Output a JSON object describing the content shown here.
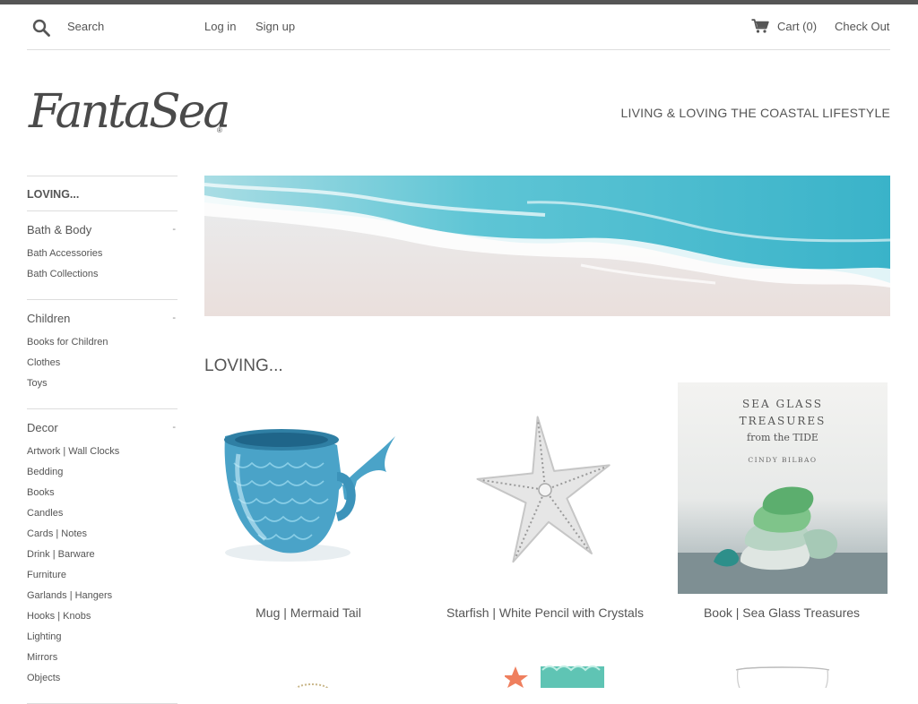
{
  "header": {
    "search_placeholder": "Search",
    "login_label": "Log in",
    "signup_label": "Sign up",
    "cart_label": "Cart (0)",
    "checkout_label": "Check Out"
  },
  "brand": {
    "logo_text": "FantaSea",
    "tagline": "LIVING & LOVING THE COASTAL LIFESTYLE"
  },
  "sidebar": {
    "current": "LOVING...",
    "groups": [
      {
        "label": "Bath & Body",
        "toggle": "-",
        "items": [
          "Bath Accessories",
          "Bath Collections"
        ]
      },
      {
        "label": "Children",
        "toggle": "-",
        "items": [
          "Books for Children",
          "Clothes",
          "Toys"
        ]
      },
      {
        "label": "Decor",
        "toggle": "-",
        "items": [
          "Artwork | Wall Clocks",
          "Bedding",
          "Books",
          "Candles",
          "Cards | Notes",
          "Drink | Barware",
          "Furniture",
          "Garlands | Hangers",
          "Hooks | Knobs",
          "Lighting",
          "Mirrors",
          "Objects"
        ]
      }
    ]
  },
  "main": {
    "section_title": "LOVING...",
    "products": [
      {
        "title": "Mug | Mermaid Tail"
      },
      {
        "title": "Starfish | White Pencil with Crystals"
      },
      {
        "title": "Book | Sea Glass Treasures",
        "cover_title_line1": "SEA GLASS",
        "cover_title_line2": "TREASURES",
        "cover_subtitle": "from the TIDE",
        "cover_author": "CINDY BILBAO"
      }
    ]
  },
  "colors": {
    "text": "#555555",
    "rule": "#dddddd",
    "mermaid_blue": "#4aa3c8",
    "sea_turquoise": "#5cc3d4"
  }
}
